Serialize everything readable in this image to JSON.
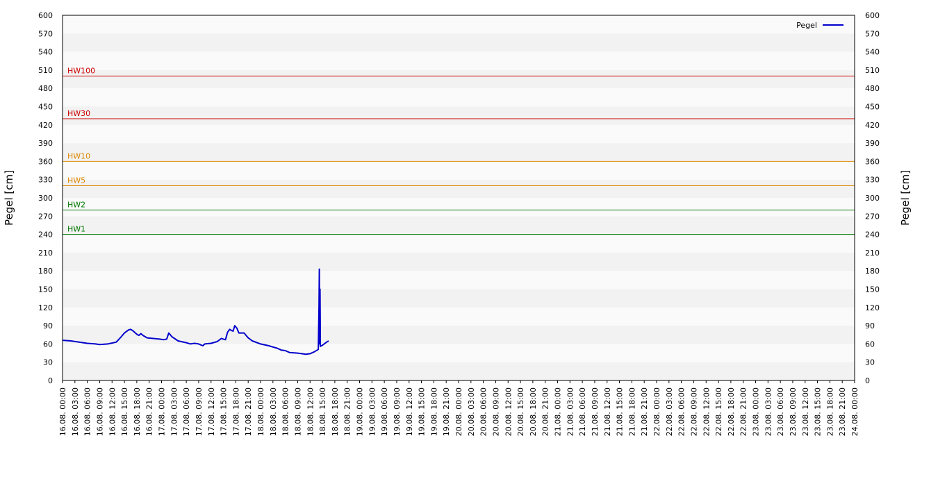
{
  "chart_data": {
    "type": "line",
    "ylabel": "Pegel [cm]",
    "ylabel_right": "Pegel [cm]",
    "ylim": [
      0,
      600
    ],
    "yticks": [
      0,
      30,
      60,
      90,
      120,
      150,
      180,
      210,
      240,
      270,
      300,
      330,
      360,
      390,
      420,
      450,
      480,
      510,
      540,
      570,
      600
    ],
    "x_tick_labels": [
      "16.08. 00:00",
      "16.08. 03:00",
      "16.08. 06:00",
      "16.08. 09:00",
      "16.08. 12:00",
      "16.08. 15:00",
      "16.08. 18:00",
      "16.08. 21:00",
      "17.08. 00:00",
      "17.08. 03:00",
      "17.08. 06:00",
      "17.08. 09:00",
      "17.08. 12:00",
      "17.08. 15:00",
      "17.08. 18:00",
      "17.08. 21:00",
      "18.08. 00:00",
      "18.08. 03:00",
      "18.08. 06:00",
      "18.08. 09:00",
      "18.08. 12:00",
      "18.08. 15:00",
      "18.08. 18:00",
      "18.08. 21:00",
      "19.08. 00:00",
      "19.08. 03:00",
      "19.08. 06:00",
      "19.08. 09:00",
      "19.08. 12:00",
      "19.08. 15:00",
      "19.08. 18:00",
      "19.08. 21:00",
      "20.08. 00:00",
      "20.08. 03:00",
      "20.08. 06:00",
      "20.08. 09:00",
      "20.08. 12:00",
      "20.08. 15:00",
      "20.08. 18:00",
      "20.08. 21:00",
      "21.08. 00:00",
      "21.08. 03:00",
      "21.08. 06:00",
      "21.08. 09:00",
      "21.08. 12:00",
      "21.08. 15:00",
      "21.08. 18:00",
      "21.08. 21:00",
      "22.08. 00:00",
      "22.08. 03:00",
      "22.08. 06:00",
      "22.08. 09:00",
      "22.08. 12:00",
      "22.08. 15:00",
      "22.08. 18:00",
      "22.08. 21:00",
      "23.08. 00:00",
      "23.08. 03:00",
      "23.08. 06:00",
      "23.08. 09:00",
      "23.08. 12:00",
      "23.08. 15:00",
      "23.08. 18:00",
      "23.08. 21:00",
      "24.08. 00:00"
    ],
    "grid": "alternating horizontal bands",
    "legend": {
      "position": "top-right",
      "entries": [
        {
          "name": "Pegel",
          "color": "#0000cc"
        }
      ]
    },
    "thresholds": [
      {
        "label": "HW100",
        "value": 500,
        "color": "#cc0000"
      },
      {
        "label": "HW30",
        "value": 430,
        "color": "#cc0000"
      },
      {
        "label": "HW10",
        "value": 360,
        "color": "#dd8800"
      },
      {
        "label": "HW5",
        "value": 320,
        "color": "#dd8800"
      },
      {
        "label": "HW2",
        "value": 280,
        "color": "#007700"
      },
      {
        "label": "HW1",
        "value": 240,
        "color": "#007700"
      }
    ],
    "series": [
      {
        "name": "Pegel",
        "color": "#0000cc",
        "points": [
          [
            "16.08. 00:00",
            66
          ],
          [
            "16.08. 02:00",
            65
          ],
          [
            "16.08. 04:00",
            63
          ],
          [
            "16.08. 06:00",
            61
          ],
          [
            "16.08. 08:00",
            60
          ],
          [
            "16.08. 09:00",
            59
          ],
          [
            "16.08. 11:00",
            60
          ],
          [
            "16.08. 13:00",
            63
          ],
          [
            "16.08. 14:00",
            70
          ],
          [
            "16.08. 15:00",
            78
          ],
          [
            "16.08. 16:00",
            83
          ],
          [
            "16.08. 16:30",
            84
          ],
          [
            "16.08. 17:00",
            82
          ],
          [
            "16.08. 18:00",
            76
          ],
          [
            "16.08. 18:30",
            74
          ],
          [
            "16.08. 19:00",
            77
          ],
          [
            "16.08. 19:30",
            74
          ],
          [
            "16.08. 20:30",
            70
          ],
          [
            "16.08. 22:00",
            69
          ],
          [
            "16.08. 23:30",
            68
          ],
          [
            "17.08. 00:30",
            67
          ],
          [
            "17.08. 01:15",
            68
          ],
          [
            "17.08. 01:45",
            78
          ],
          [
            "17.08. 02:30",
            72
          ],
          [
            "17.08. 04:00",
            65
          ],
          [
            "17.08. 06:00",
            62
          ],
          [
            "17.08. 07:00",
            60
          ],
          [
            "17.08. 08:00",
            61
          ],
          [
            "17.08. 09:00",
            60
          ],
          [
            "17.08. 10:00",
            57
          ],
          [
            "17.08. 10:30",
            60
          ],
          [
            "17.08. 12:00",
            61
          ],
          [
            "17.08. 13:30",
            64
          ],
          [
            "17.08. 14:30",
            69
          ],
          [
            "17.08. 15:00",
            68
          ],
          [
            "17.08. 15:30",
            67
          ],
          [
            "17.08. 16:00",
            79
          ],
          [
            "17.08. 16:30",
            84
          ],
          [
            "17.08. 17:00",
            82
          ],
          [
            "17.08. 17:20",
            81
          ],
          [
            "17.08. 17:45",
            90
          ],
          [
            "17.08. 18:15",
            86
          ],
          [
            "17.08. 18:45",
            78
          ],
          [
            "17.08. 20:00",
            78
          ],
          [
            "17.08. 21:00",
            70
          ],
          [
            "17.08. 22:00",
            65
          ],
          [
            "18.08. 00:00",
            60
          ],
          [
            "18.08. 02:00",
            57
          ],
          [
            "18.08. 03:00",
            55
          ],
          [
            "18.08. 04:00",
            53
          ],
          [
            "18.08. 05:00",
            50
          ],
          [
            "18.08. 06:00",
            49
          ],
          [
            "18.08. 07:00",
            46
          ],
          [
            "18.08. 09:00",
            45
          ],
          [
            "18.08. 11:00",
            43
          ],
          [
            "18.08. 12:00",
            44
          ],
          [
            "18.08. 13:00",
            47
          ],
          [
            "18.08. 14:00",
            51
          ],
          [
            "18.08. 14:10",
            120
          ],
          [
            "18.08. 14:15",
            183
          ],
          [
            "18.08. 14:20",
            60
          ],
          [
            "18.08. 14:25",
            150
          ],
          [
            "18.08. 14:30",
            56
          ],
          [
            "18.08. 15:00",
            58
          ],
          [
            "18.08. 16:00",
            63
          ],
          [
            "18.08. 16:30",
            65
          ]
        ]
      }
    ]
  }
}
